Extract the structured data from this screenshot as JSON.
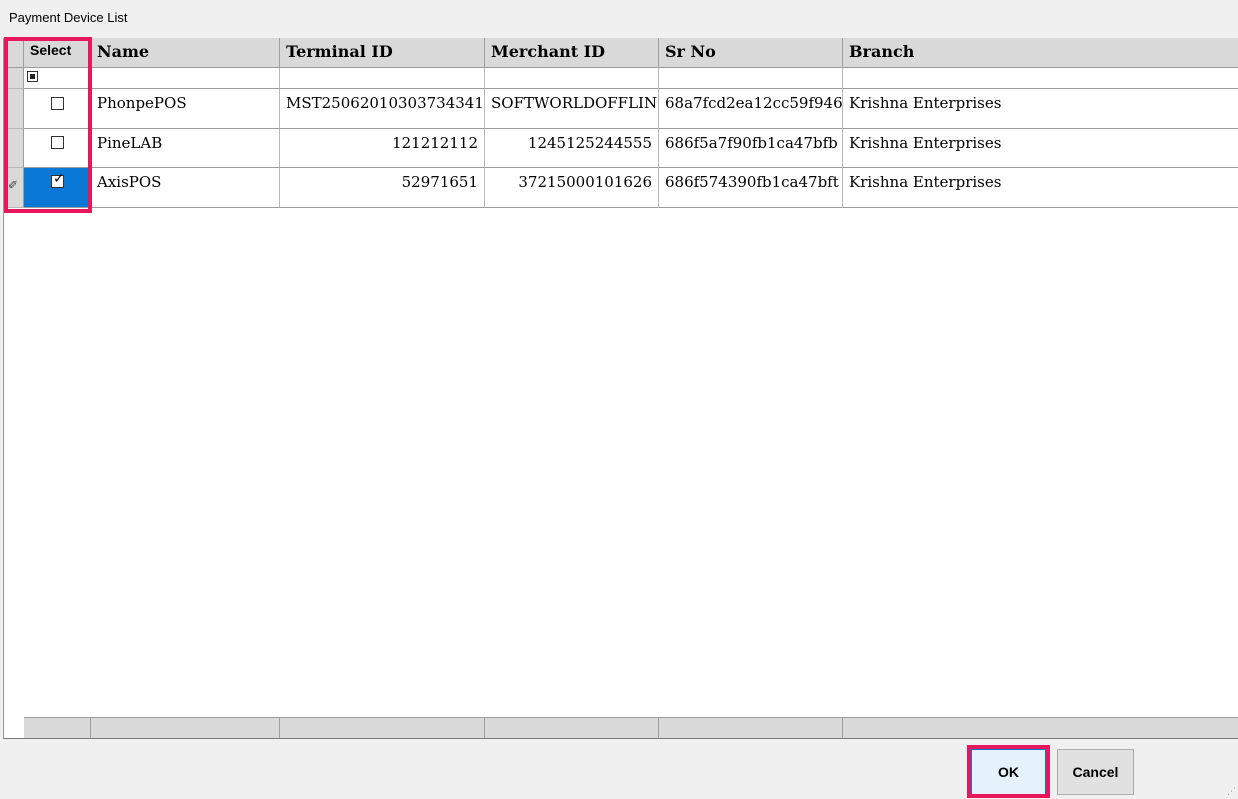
{
  "window": {
    "title": "Payment Device List"
  },
  "grid": {
    "columns": [
      "Select",
      "Name",
      "Terminal ID",
      "Merchant ID",
      "Sr No",
      "Branch"
    ],
    "rows": [
      {
        "checked": false,
        "name": "PhonpePOS",
        "terminal_id": "MST25062010303734341",
        "merchant_id": "SOFTWORLDOFFLINE",
        "sr_no": "68a7fcd2ea12cc59f946",
        "branch": "Krishna Enterprises"
      },
      {
        "checked": false,
        "name": "PineLAB",
        "terminal_id": "121212112",
        "merchant_id": "1245125244555",
        "sr_no": "686f5a7f90fb1ca47bfb",
        "branch": "Krishna Enterprises"
      },
      {
        "checked": true,
        "name": "AxisPOS",
        "terminal_id": "52971651",
        "merchant_id": "37215000101626",
        "sr_no": "686f574390fb1ca47bft",
        "branch": "Krishna Enterprises"
      }
    ],
    "check_mark": "✓",
    "edit_indicator": "✐"
  },
  "buttons": {
    "ok_label": "OK",
    "cancel_label": "Cancel"
  },
  "colors": {
    "highlight": "#e8175d",
    "selected_cell": "#0a78d7",
    "header_bg": "#d9d9d9"
  }
}
